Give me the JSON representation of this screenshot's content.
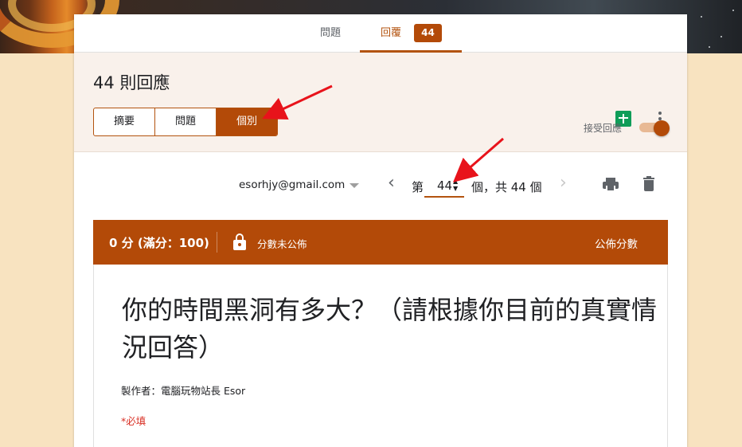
{
  "tabs": [
    {
      "label": "問題"
    },
    {
      "label": "回覆",
      "count": "44"
    }
  ],
  "summary": {
    "title": "44 則回應",
    "segments": [
      "摘要",
      "問題",
      "個別"
    ],
    "accept_label": "接受回應",
    "accepting": true
  },
  "navigator": {
    "email": "esorhjy@gmail.com",
    "prefix": "第",
    "current": "44",
    "suffix": "個，共 44 個"
  },
  "score": {
    "text": "0 分 (滿分：100)",
    "unreleased": "分數未公佈",
    "release_label": "公佈分數"
  },
  "form": {
    "title": "你的時間黑洞有多大？（請根據你目前的真實情況回答）",
    "author": "製作者：電腦玩物站長 Esor",
    "required_note": "*必填"
  },
  "colors": {
    "accent": "#b34a08",
    "background": "#f8e3c0",
    "sheets": "#0f9d58",
    "annotation_arrow": "#e8131b"
  }
}
